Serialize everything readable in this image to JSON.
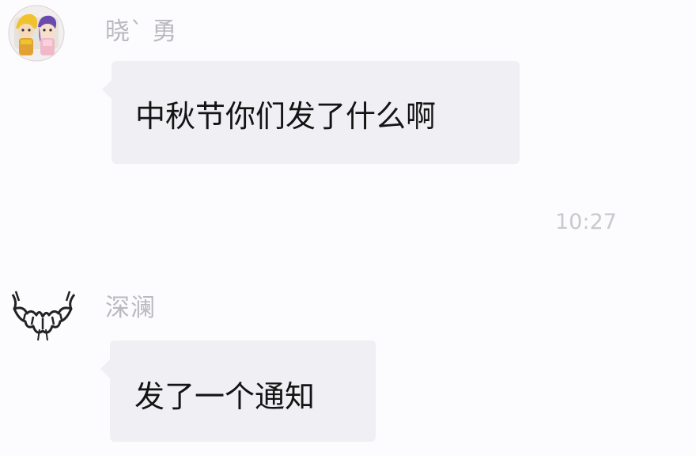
{
  "chat": {
    "messages": [
      {
        "sender": "晓ˋ 勇",
        "avatar_icon": "cartoon-couple-avatar-icon",
        "text": "中秋节你们发了什么啊"
      },
      {
        "sender": "深澜",
        "avatar_icon": "bat-avatar-icon",
        "text": "发了一个通知"
      }
    ],
    "timestamp": "10:27"
  },
  "colors": {
    "background": "#fcfbfd",
    "bubble": "#f0eff3",
    "sender_name": "#b9b9bf",
    "message_text": "#141414",
    "timestamp": "#c9c9cd"
  }
}
